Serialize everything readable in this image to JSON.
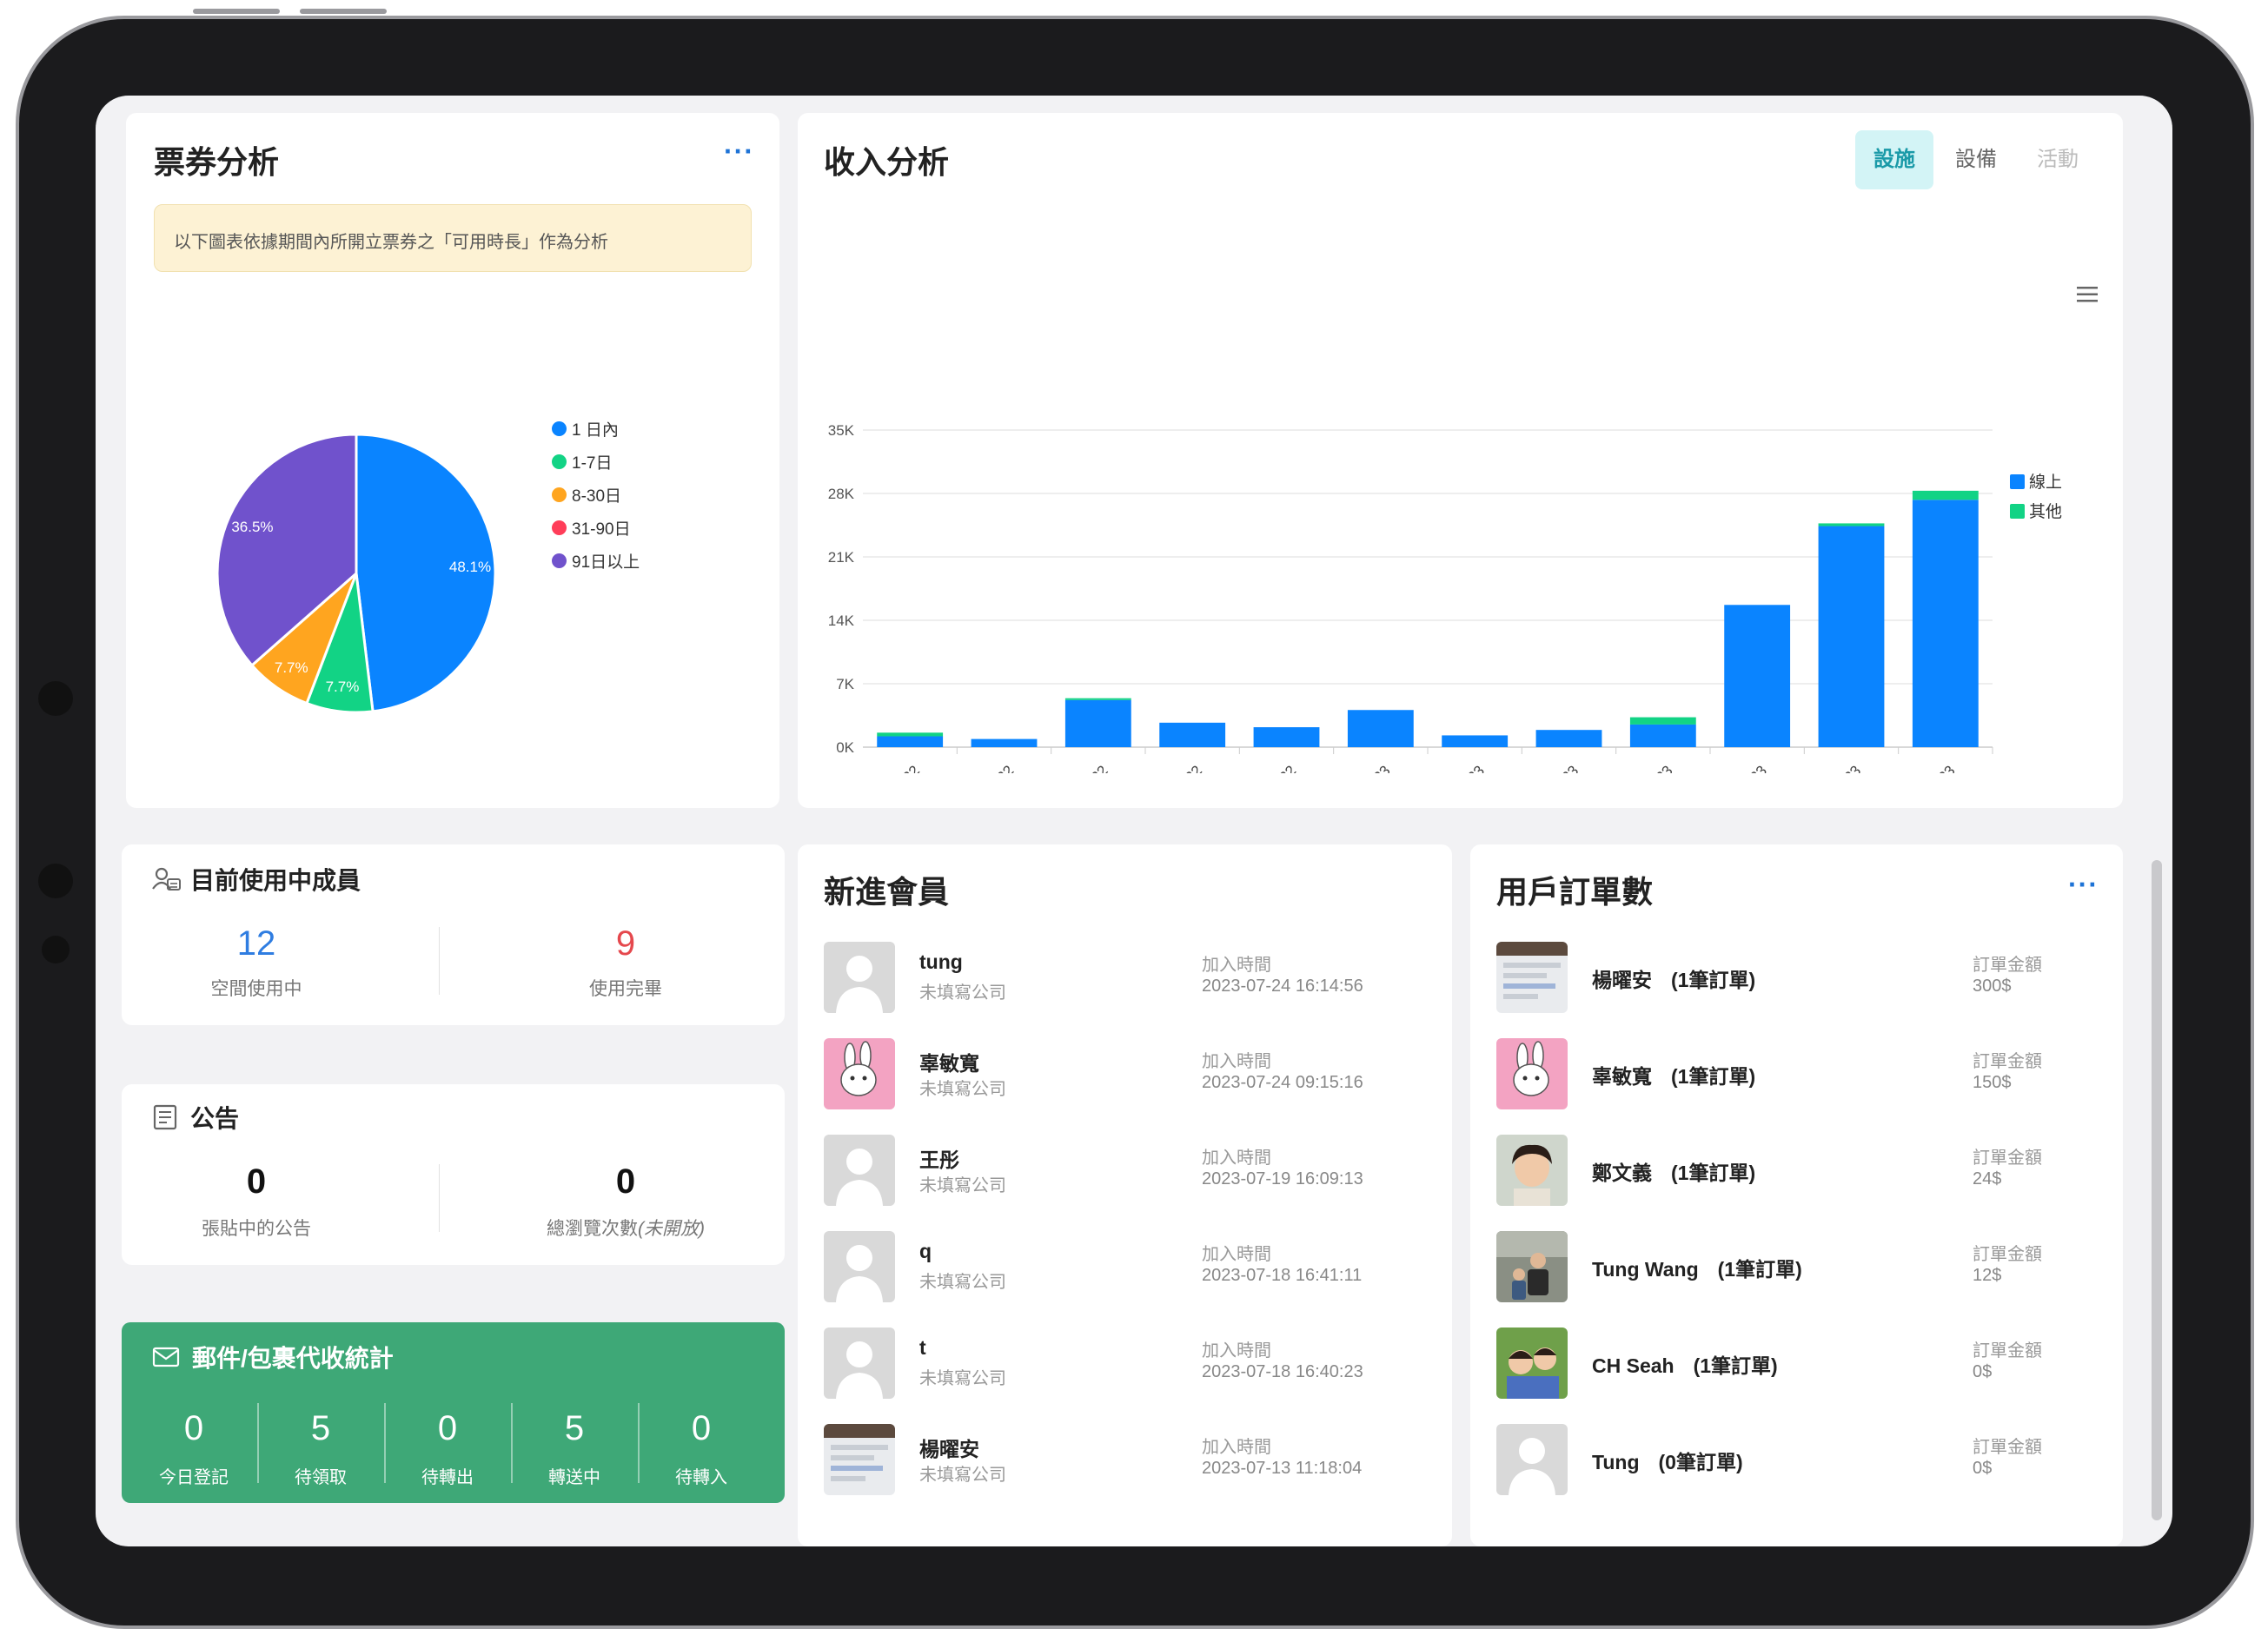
{
  "ticket_analysis": {
    "title": "票券分析",
    "notice": "以下圖表依據期間內所開立票券之「可用時長」作為分析",
    "pie_labels": [
      "48.1%",
      "7.7%",
      "7.7%",
      "36.5%"
    ],
    "legend": [
      "1 日內",
      "1-7日",
      "8-30日",
      "31-90日",
      "91日以上"
    ]
  },
  "revenue_analysis": {
    "title": "收入分析",
    "tabs": [
      "設施",
      "設備",
      "活動"
    ]
  },
  "chart_data": [
    {
      "type": "pie",
      "title": "票券分析",
      "categories": [
        "1 日內",
        "1-7日",
        "8-30日",
        "31-90日",
        "91日以上"
      ],
      "values": [
        48.1,
        7.7,
        7.7,
        0,
        36.5
      ],
      "colors": [
        "#0a84ff",
        "#12d385",
        "#ffa51f",
        "#ff3d59",
        "#7052cc"
      ],
      "legend_position": "right"
    },
    {
      "type": "bar",
      "title": "收入分析",
      "stacked": true,
      "categories": [
        "August'22",
        "September'22",
        "October'22",
        "November'22",
        "December'22",
        "January'23",
        "February'23",
        "March'23",
        "April'23",
        "May'23",
        "June'23",
        "July'23"
      ],
      "series": [
        {
          "name": "線上",
          "color": "#0a84ff",
          "values": [
            1200,
            900,
            5200,
            2700,
            2200,
            4100,
            1300,
            1900,
            2500,
            15700,
            24400,
            27300
          ]
        },
        {
          "name": "其他",
          "color": "#12d385",
          "values": [
            400,
            0,
            200,
            0,
            0,
            0,
            0,
            0,
            800,
            0,
            300,
            1000
          ]
        }
      ],
      "yticks": [
        "0K",
        "7K",
        "14K",
        "21K",
        "28K",
        "35K"
      ],
      "ylim": [
        0,
        35000
      ],
      "grid": true,
      "legend_position": "top-right"
    }
  ],
  "colors": {
    "online": "#0a84ff",
    "other": "#12d385",
    "accent": "#1a9aa8",
    "mail_green": "#3ea877",
    "red_stat": "#e5484d",
    "blue_stat": "#2f7de1"
  },
  "members_in_use": {
    "title": "目前使用中成員",
    "stats": [
      {
        "value": "12",
        "label": "空間使用中"
      },
      {
        "value": "9",
        "label": "使用完畢"
      }
    ]
  },
  "announcement": {
    "title": "公告",
    "stats": [
      {
        "value": "0",
        "label": "張貼中的公告"
      },
      {
        "value": "0",
        "label": "總瀏覽次數",
        "note": "(未開放)"
      }
    ]
  },
  "mail": {
    "title": "郵件/包裹代收統計",
    "stats": [
      {
        "value": "0",
        "label": "今日登記"
      },
      {
        "value": "5",
        "label": "待領取"
      },
      {
        "value": "0",
        "label": "待轉出"
      },
      {
        "value": "5",
        "label": "轉送中"
      },
      {
        "value": "0",
        "label": "待轉入"
      }
    ]
  },
  "new_members": {
    "title": "新進會員",
    "join_label": "加入時間",
    "items": [
      {
        "name": "tung",
        "company": "未填寫公司",
        "joined": "2023-07-24 16:14:56",
        "avatar": "default"
      },
      {
        "name": "辜敏寬",
        "company": "未填寫公司",
        "joined": "2023-07-24 09:15:16",
        "avatar": "rabbit"
      },
      {
        "name": "王彤",
        "company": "未填寫公司",
        "joined": "2023-07-19 16:09:13",
        "avatar": "default"
      },
      {
        "name": "q",
        "company": "未填寫公司",
        "joined": "2023-07-18 16:41:11",
        "avatar": "default"
      },
      {
        "name": "t",
        "company": "未填寫公司",
        "joined": "2023-07-18 16:40:23",
        "avatar": "default"
      },
      {
        "name": "楊曜安",
        "company": "未填寫公司",
        "joined": "2023-07-13 11:18:04",
        "avatar": "screenshot"
      }
    ]
  },
  "user_orders": {
    "title": "用戶訂單數",
    "amount_label": "訂單金額",
    "items": [
      {
        "name": "楊曜安",
        "orders": "(1筆訂單)",
        "amount": "300$",
        "avatar": "screenshot"
      },
      {
        "name": "辜敏寬",
        "orders": "(1筆訂單)",
        "amount": "150$",
        "avatar": "rabbit"
      },
      {
        "name": "鄭文義",
        "orders": "(1筆訂單)",
        "amount": "24$",
        "avatar": "photo-child"
      },
      {
        "name": "Tung Wang",
        "orders": "(1筆訂單)",
        "amount": "12$",
        "avatar": "photo-people"
      },
      {
        "name": "CH Seah",
        "orders": "(1筆訂單)",
        "amount": "0$",
        "avatar": "photo-kids"
      },
      {
        "name": "Tung",
        "orders": "(0筆訂單)",
        "amount": "0$",
        "avatar": "default"
      }
    ]
  }
}
